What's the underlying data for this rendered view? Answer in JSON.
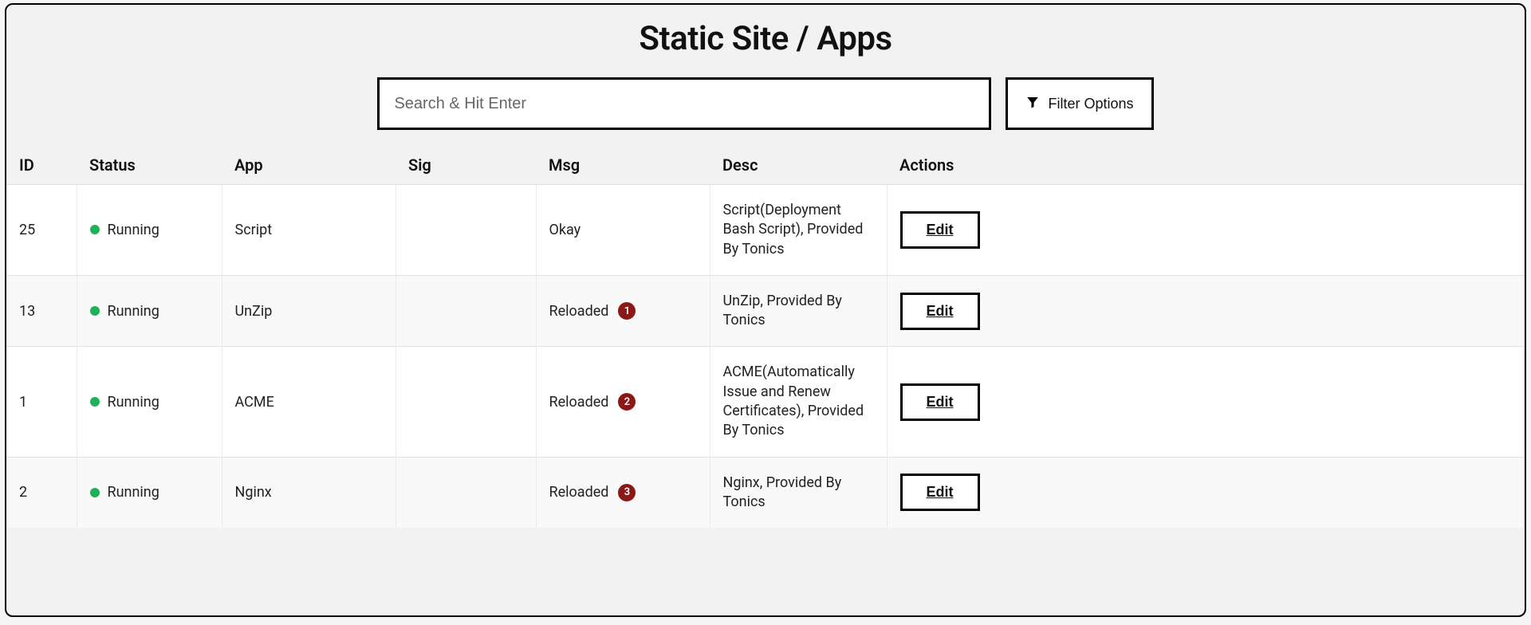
{
  "page": {
    "title": "Static Site / Apps"
  },
  "search": {
    "placeholder": "Search & Hit Enter",
    "value": ""
  },
  "filter": {
    "label": "Filter Options"
  },
  "table": {
    "headers": {
      "id": "ID",
      "status": "Status",
      "app": "App",
      "sig": "Sig",
      "msg": "Msg",
      "desc": "Desc",
      "actions": "Actions"
    },
    "rows": [
      {
        "id": "25",
        "status_color": "green",
        "status_label": "Running",
        "app": "Script",
        "sig": "",
        "msg": "Okay",
        "badge": "",
        "desc": "Script(Deployment Bash Script), Provided By Tonics",
        "action_label": "Edit"
      },
      {
        "id": "13",
        "status_color": "green",
        "status_label": "Running",
        "app": "UnZip",
        "sig": "",
        "msg": "Reloaded",
        "badge": "1",
        "desc": "UnZip, Provided By Tonics",
        "action_label": "Edit"
      },
      {
        "id": "1",
        "status_color": "green",
        "status_label": "Running",
        "app": "ACME",
        "sig": "",
        "msg": "Reloaded",
        "badge": "2",
        "desc": "ACME(Automatically Issue and Renew Certificates), Provided By Tonics",
        "action_label": "Edit"
      },
      {
        "id": "2",
        "status_color": "green",
        "status_label": "Running",
        "app": "Nginx",
        "sig": "",
        "msg": "Reloaded",
        "badge": "3",
        "desc": "Nginx, Provided By Tonics",
        "action_label": "Edit"
      }
    ]
  }
}
